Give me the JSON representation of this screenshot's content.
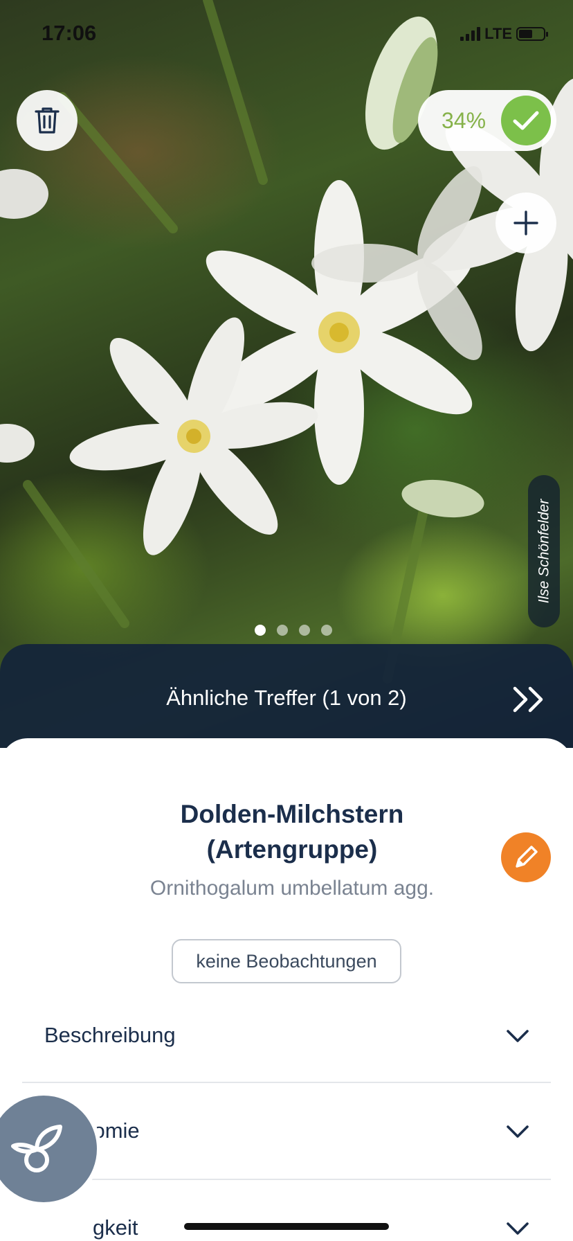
{
  "status_bar": {
    "time": "17:06",
    "network": "LTE"
  },
  "photo": {
    "confidence_percent": "34%",
    "photographer": "Ilse Schönfelder",
    "page_count": 4,
    "active_page": 1
  },
  "similar": {
    "label": "Ähnliche Treffer (1 von 2)"
  },
  "species": {
    "title_line1": "Dolden-Milchstern",
    "title_line2": "(Artengruppe)",
    "latin_name": "Ornithogalum umbellatum agg.",
    "observations": "keine Beobachtungen"
  },
  "sections": [
    {
      "label": "Beschreibung"
    },
    {
      "label": "onomie"
    },
    {
      "label": "gkeit"
    }
  ],
  "colors": {
    "accent_green": "#7cc04a",
    "accent_orange": "#f08227",
    "navy": "#1b2e4b",
    "fab": "#6f8196"
  },
  "icons": [
    "trash-icon",
    "check-icon",
    "plus-icon",
    "double-chevron-right-icon",
    "pencil-icon",
    "chevron-down-icon",
    "flower-logo-icon"
  ]
}
